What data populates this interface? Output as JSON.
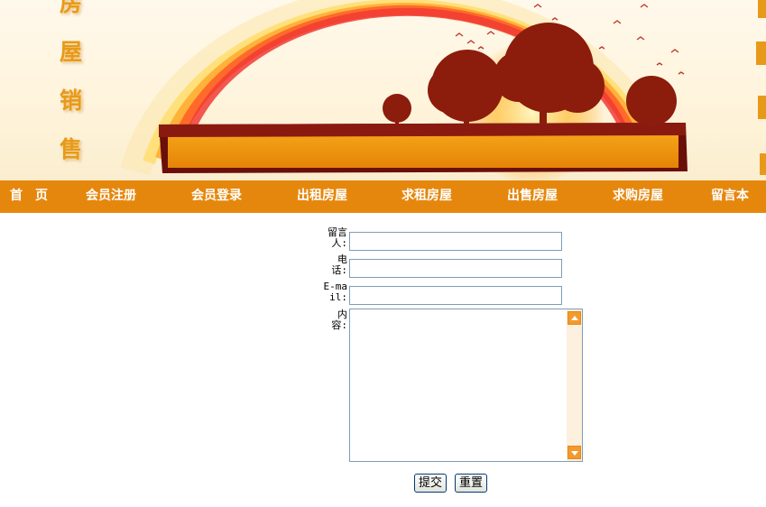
{
  "banner": {
    "vertical_chars_left": [
      "房",
      "屋",
      "销",
      "售"
    ]
  },
  "nav": {
    "items": [
      {
        "label": "首　页"
      },
      {
        "label": "会员注册"
      },
      {
        "label": "会员登录"
      },
      {
        "label": "出租房屋"
      },
      {
        "label": "求租房屋"
      },
      {
        "label": "出售房屋"
      },
      {
        "label": "求购房屋"
      },
      {
        "label": "留言本"
      }
    ]
  },
  "form": {
    "name_label": "留言人:",
    "phone_label": "电话:",
    "email_label": "E-mail:",
    "content_label": "内容:",
    "name_value": "",
    "phone_value": "",
    "email_value": "",
    "content_value": "",
    "submit_label": "提交",
    "reset_label": "重置"
  },
  "colors": {
    "nav_background": "#e6870d",
    "nav_text": "#ffffff",
    "scrollbar_button": "#f29a2e"
  }
}
